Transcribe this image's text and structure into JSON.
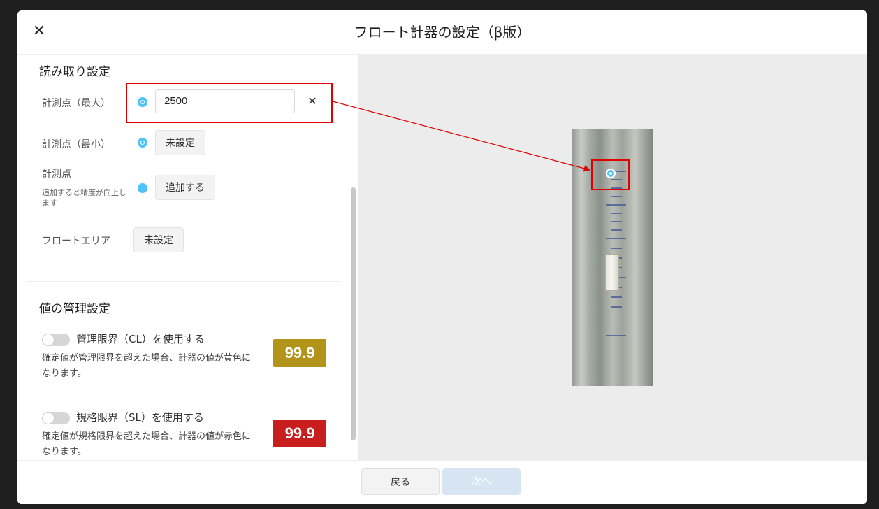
{
  "dialog": {
    "title": "フロート計器の設定（β版）",
    "close_icon": "close-icon"
  },
  "reading": {
    "section_title": "読み取り設定",
    "max_point": {
      "label": "計測点（最大）",
      "value": "2500"
    },
    "min_point": {
      "label": "計測点（最小）",
      "button": "未設定"
    },
    "point": {
      "label": "計測点",
      "note": "追加すると精度が向上します",
      "button": "追加する"
    },
    "float_area": {
      "label": "フロートエリア",
      "button": "未設定"
    }
  },
  "management": {
    "section_title": "値の管理設定",
    "cl": {
      "toggle_label": "管理限界（CL）を使用する",
      "description": "確定値が管理限界を超えた場合、計器の値が黄色になります。",
      "badge": "99.9",
      "badge_color": "#b3941b",
      "enabled": false
    },
    "sl": {
      "toggle_label": "規格限界（SL）を使用する",
      "description": "確定値が規格限界を超えた場合、計器の値が赤色になります。",
      "badge": "99.9",
      "badge_color": "#c81e1e",
      "enabled": false
    }
  },
  "footer": {
    "back": "戻る",
    "next": "次へ"
  },
  "colors": {
    "marker": "#4fc3f7",
    "highlight": "#e00000",
    "next_disabled": "#d6e5f1"
  }
}
